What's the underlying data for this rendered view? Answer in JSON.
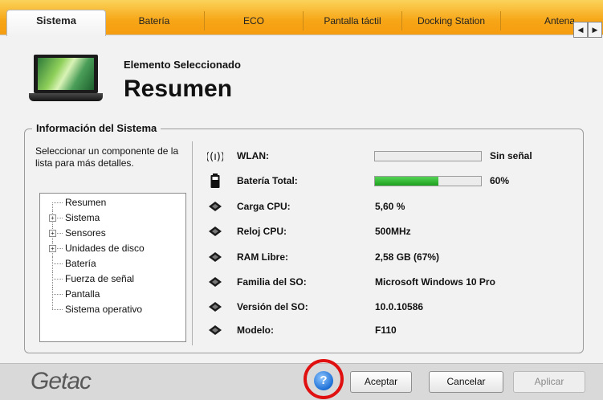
{
  "tabs": [
    {
      "label": "Sistema",
      "active": true
    },
    {
      "label": "Batería"
    },
    {
      "label": "ECO"
    },
    {
      "label": "Pantalla táctil"
    },
    {
      "label": "Docking Station"
    },
    {
      "label": "Antena"
    }
  ],
  "tab_scroll": {
    "left": "◀",
    "right": "▶"
  },
  "header": {
    "subtitle": "Elemento Seleccionado",
    "title": "Resumen",
    "icon": "laptop-icon"
  },
  "system_info": {
    "group_title": "Información del Sistema",
    "hint": "Seleccionar un componente de la lista para más detalles.",
    "tree": [
      {
        "label": "Resumen",
        "expandable": false
      },
      {
        "label": "Sistema",
        "expandable": true
      },
      {
        "label": "Sensores",
        "expandable": true
      },
      {
        "label": "Unidades de disco",
        "expandable": true
      },
      {
        "label": "Batería",
        "expandable": false
      },
      {
        "label": "Fuerza de señal",
        "expandable": false
      },
      {
        "label": "Pantalla",
        "expandable": false
      },
      {
        "label": "Sistema operativo",
        "expandable": false
      }
    ],
    "rows": {
      "wlan": {
        "label": "WLAN:",
        "value": "Sin señal",
        "level": 0,
        "icon": "wifi-antenna-icon"
      },
      "battery": {
        "label": "Batería Total:",
        "value": "60%",
        "level": 0.6,
        "icon": "battery-icon"
      },
      "cpu_load": {
        "label": "Carga CPU:",
        "value": "5,60 %",
        "icon": "chip-icon"
      },
      "cpu_clock": {
        "label": "Reloj CPU:",
        "value": "500MHz",
        "icon": "chip-icon"
      },
      "ram": {
        "label": "RAM Libre:",
        "value": "2,58 GB (67%)",
        "icon": "chip-icon"
      },
      "os_family": {
        "label": "Familia del SO:",
        "value": "Microsoft Windows 10 Pro",
        "icon": "chip-icon"
      },
      "os_version": {
        "label": "Versión del SO:",
        "value": "10.0.10586",
        "icon": "chip-icon"
      },
      "model": {
        "label": "Modelo:",
        "value": "F110",
        "icon": "chip-icon"
      }
    }
  },
  "footer": {
    "brand": "Getac",
    "help": "?",
    "accept": "Aceptar",
    "cancel": "Cancelar",
    "apply": "Aplicar"
  },
  "colors": {
    "tab_bar": "#f7a516",
    "battery_fill": "#1ea11e",
    "help_highlight": "#e01010"
  }
}
